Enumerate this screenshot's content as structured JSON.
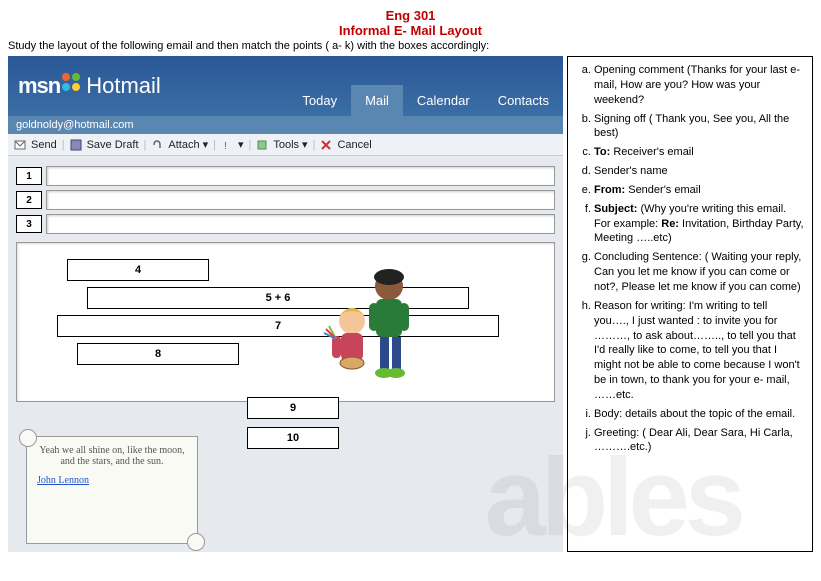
{
  "header": {
    "title1": "Eng 301",
    "title2": "Informal E- Mail Layout",
    "instruction": "Study the layout of the following email and then match the points ( a- k) with the boxes accordingly:"
  },
  "hotmail": {
    "brand_msn": "msn",
    "brand_hotmail": "Hotmail",
    "nav": {
      "today": "Today",
      "mail": "Mail",
      "calendar": "Calendar",
      "contacts": "Contacts"
    },
    "account": "goldnoldy@hotmail.com",
    "toolbar": {
      "send": "Send",
      "save_draft": "Save Draft",
      "attach": "Attach",
      "tools": "Tools",
      "cancel": "Cancel"
    },
    "fields": {
      "f1": "1",
      "f2": "2",
      "f3": "3"
    },
    "boxes": {
      "b4": "4",
      "b56": "5 + 6",
      "b7": "7",
      "b8": "8",
      "b9": "9",
      "b10": "10"
    }
  },
  "quote": {
    "text": "Yeah we all shine on, like the moon, and the stars, and the sun.",
    "author": "John Lennon"
  },
  "options": {
    "a": "Opening comment (Thanks for your last e-mail, How are you? How was your weekend?",
    "b": "Signing off ( Thank you, See you, All the best)",
    "c_label": "To:",
    "c_rest": " Receiver's email",
    "d": "Sender's name",
    "e_label": "From:",
    "e_rest": "  Sender's email",
    "f_label": "Subject:",
    "f_rest": " (Why you're writing this email. For example: ",
    "f_re": "Re:",
    "f_tail": " Invitation, Birthday Party, Meeting …..etc)",
    "g": "Concluding Sentence: ( Waiting your reply, Can you let me know if you can come or not?, Please let me know if you can come)",
    "h": "Reason for writing: I'm writing to tell you…., I just wanted : to invite you for ………, to ask about……..,  to tell you that I'd really like to come,  to tell you that I might not be able to come because I won't be in town, to thank you for your e- mail, ……etc.",
    "i": "Body: details about the topic of the email.",
    "j": "Greeting: ( Dear Ali, Dear Sara, Hi Carla, ……….etc.)"
  }
}
